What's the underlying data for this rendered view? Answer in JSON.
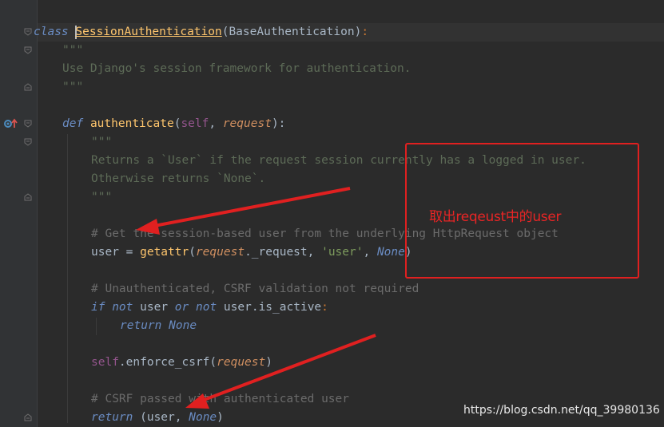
{
  "code": {
    "line_class": {
      "kw": "class",
      "name": "SessionAuthentication",
      "base": "(BaseAuthentication)",
      "colon": ":"
    },
    "doc_open1": "\"\"\"",
    "doc_text1": "Use Django's session framework for authentication.",
    "doc_close1": "\"\"\"",
    "line_def": {
      "kw": "def",
      "name": "authenticate",
      "open": "(",
      "self": "self",
      "comma": ", ",
      "param": "request",
      "close": "):"
    },
    "doc_open2": "\"\"\"",
    "doc_text2a": "Returns a `User` if the request session currently has a logged in user.",
    "doc_text2b": "Otherwise returns `None`.",
    "doc_close2": "\"\"\"",
    "comment1": "# Get the session-based user from the underlying HttpRequest object",
    "line_user": {
      "var": "user = ",
      "fn": "getattr",
      "open": "(",
      "param": "request",
      "attr": "._request, ",
      "str": "'user'",
      "comma": ", ",
      "none": "None",
      "close": ")"
    },
    "comment2": "# Unauthenticated, CSRF validation not required",
    "line_if": {
      "kw_if": "if",
      "kw_not": "not",
      "user1": " user ",
      "kw_or": "or",
      "kw_not2": "not",
      "rest": " user.is_active",
      "colon": ":"
    },
    "line_return_none": {
      "kw": "return",
      "none": "None"
    },
    "line_csrf": {
      "self": "self",
      "call": ".enforce_csrf(",
      "param": "request",
      "close": ")"
    },
    "comment3": "# CSRF passed with authenticated user",
    "line_return": {
      "kw": "return",
      "open": " (user, ",
      "none": "None",
      "close": ")"
    }
  },
  "annotation": {
    "label": "取出reqeust中的user",
    "color": "#e02020"
  },
  "watermark": "https://blog.csdn.net/qq_39980136"
}
